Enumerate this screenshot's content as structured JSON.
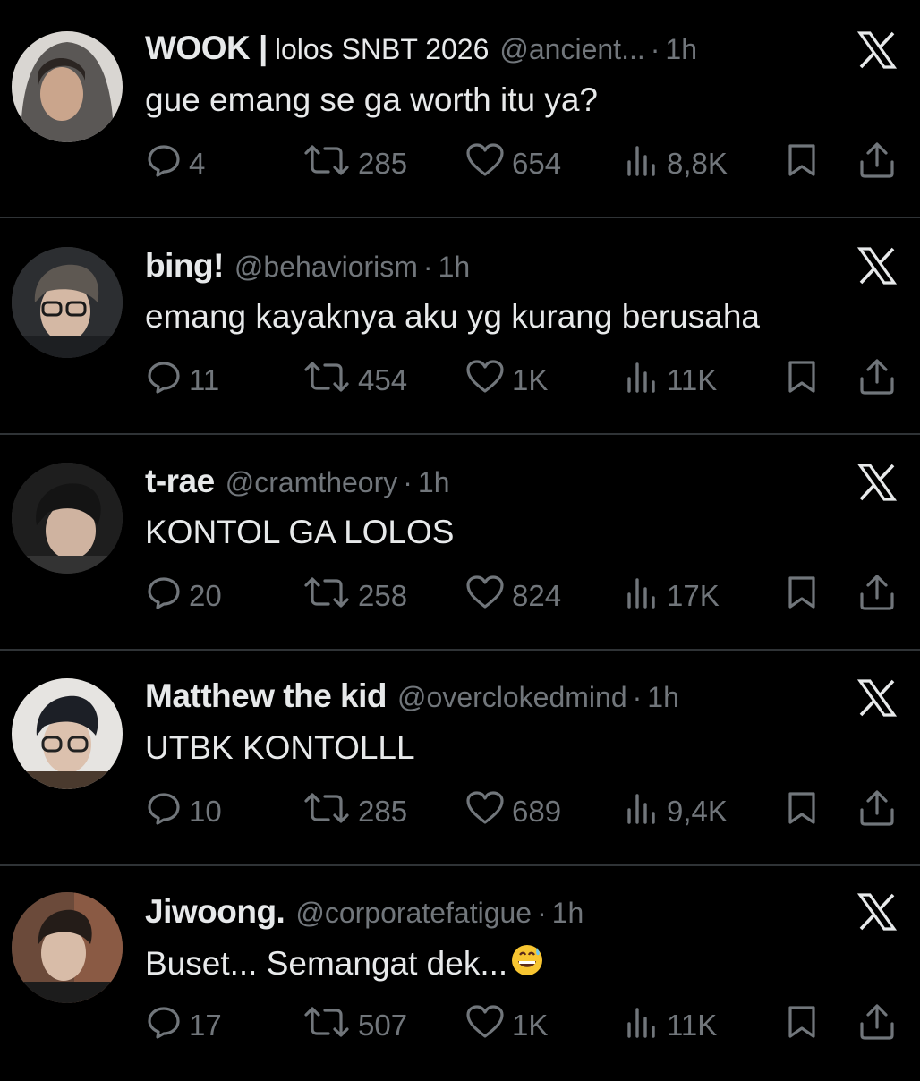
{
  "tweets": [
    {
      "name": "WOOK |",
      "name_suffix": "lolos SNBT 2026",
      "handle": "@ancient...",
      "dot": "·",
      "time": "1h",
      "text": "gue emang se ga worth itu ya?",
      "replies": "4",
      "retweets": "285",
      "likes": "654",
      "views": "8,8K"
    },
    {
      "name": "bing!",
      "name_suffix": "",
      "handle": "@behaviorism",
      "dot": "·",
      "time": "1h",
      "text": "emang kayaknya aku yg kurang berusaha",
      "replies": "11",
      "retweets": "454",
      "likes": "1K",
      "views": "11K"
    },
    {
      "name": "t-rae",
      "name_suffix": "",
      "handle": "@cramtheory",
      "dot": "·",
      "time": "1h",
      "text": "KONTOL GA LOLOS",
      "replies": "20",
      "retweets": "258",
      "likes": "824",
      "views": "17K"
    },
    {
      "name": "Matthew the kid",
      "name_suffix": "",
      "handle": "@overclokedmind",
      "dot": "·",
      "time": "1h",
      "text": "UTBK KONTOLLL",
      "replies": "10",
      "retweets": "285",
      "likes": "689",
      "views": "9,4K"
    },
    {
      "name": "Jiwoong.",
      "name_suffix": "",
      "handle": "@corporatefatigue",
      "dot": "·",
      "time": "1h",
      "text": "Buset... Semangat dek...",
      "text_emoji": "grinning-face-with-sweat",
      "replies": "17",
      "retweets": "507",
      "likes": "1K",
      "views": "11K"
    }
  ],
  "icons": {
    "reply": "reply-icon",
    "retweet": "retweet-icon",
    "like": "heart-icon",
    "views": "views-icon",
    "bookmark": "bookmark-icon",
    "share": "share-icon",
    "platform": "x-logo-icon"
  },
  "colors": {
    "background": "#000000",
    "primary_text": "#e7e9ea",
    "secondary_text": "#71767b",
    "divider": "#2f3336"
  }
}
